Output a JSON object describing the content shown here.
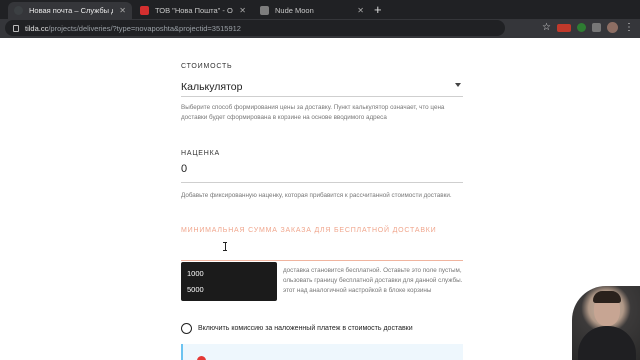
{
  "browser": {
    "tabs": [
      {
        "title": "Новая почта – Службы доставки",
        "favicon_color": "#3c4043",
        "active": true
      },
      {
        "title": "ТОВ \"Нова Пошта\" - Особистий кабінет",
        "favicon_color": "#d32f2f",
        "active": false
      },
      {
        "title": "Nude Moon",
        "favicon_color": "#7d7d7d",
        "active": false
      }
    ],
    "new_tab_glyph": "+",
    "url_host": "tilda.cc",
    "url_path": "/projects/deliveries/?type=novaposhta&projectid=3515912",
    "star_glyph": "☆",
    "menu_glyph": "⋮",
    "extension_label": "ABP"
  },
  "form": {
    "cost": {
      "label": "СТОИМОСТЬ",
      "selected": "Калькулятор",
      "hint": "Выберите способ формирования цены за доставку. Пункт калькулятор означает, что цена доставки будет сформирована в корзине на основе вводимого адреса"
    },
    "markup": {
      "label": "НАЦЕНКА",
      "value": "0",
      "hint": "Добавьте фиксированную наценку, которая прибавится к рассчитанной стоимости доставки."
    },
    "min_free": {
      "label": "МИНИМАЛЬНАЯ СУММА ЗАКАЗА ДЛЯ БЕСПЛАТНОЙ ДОСТАВКИ",
      "value": "",
      "hint_line1": "доставка становится бесплатной. Оставьте это поле пустым,",
      "hint_line2": "ользовать границу бесплатной доставки для данной службы.",
      "hint_line3": "этот над аналогичной настройкой в блоке корзины",
      "suggestions": [
        "1000",
        "5000"
      ]
    },
    "commission": {
      "label": "Включить комиссию за наложенный платеж в стоимость доставки",
      "checked": false
    }
  },
  "colors": {
    "accent": "#f0a68d",
    "notice_bg": "#eef7fd",
    "notice_border": "#6cc3f0"
  }
}
